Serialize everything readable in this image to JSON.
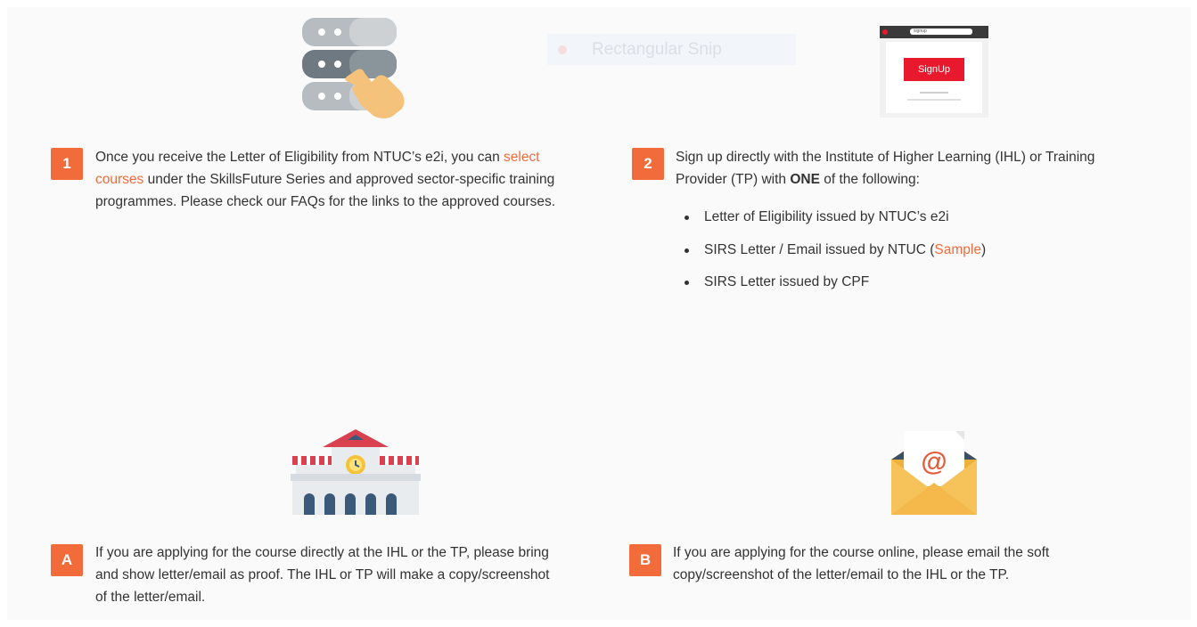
{
  "overlay": {
    "snip_label": "Rectangular Snip"
  },
  "step1": {
    "badge": "1",
    "text_before": "Once you receive the Letter of Eligibility from NTUC’s e2i, you can ",
    "link_line1": "select",
    "link_line2": "courses",
    "text_line2_after": " under the SkillsFuture Series and approved sector-specific training",
    "text_line3": "programmes. Please check our FAQs for the links to the approved courses."
  },
  "step2": {
    "badge": "2",
    "line1": "Sign up directly with the Institute of Higher Learning (IHL) or Training",
    "line2_before": "Provider (TP) with ",
    "line2_bold": "ONE",
    "line2_after": " of the following:",
    "bullets": {
      "b1": "Letter of Eligibility issued by NTUC’s e2i",
      "b2_before": "SIRS Letter / Email issued by NTUC (",
      "b2_link": "Sample",
      "b2_after": ")",
      "b3": "SIRS Letter issued by CPF"
    },
    "signup_button": "SignUp",
    "browser_url": "signup"
  },
  "stepA": {
    "badge": "A",
    "line1": "If you are applying for the course directly at the IHL or the TP, please bring",
    "line2": "and show letter/email as proof. The IHL or TP will make a copy/screenshot",
    "line3": "of the letter/email."
  },
  "stepB": {
    "badge": "B",
    "line1": "If you are applying for the course online, please email the soft",
    "line2": "copy/screenshot of the letter/email to the IHL or the TP."
  },
  "icons": {
    "server": "server-tap-icon",
    "browser": "browser-signup-icon",
    "building": "building-clock-icon",
    "email": "email-envelope-icon"
  },
  "colors": {
    "accent": "#f26b3a",
    "signup_red": "#e8192c"
  }
}
